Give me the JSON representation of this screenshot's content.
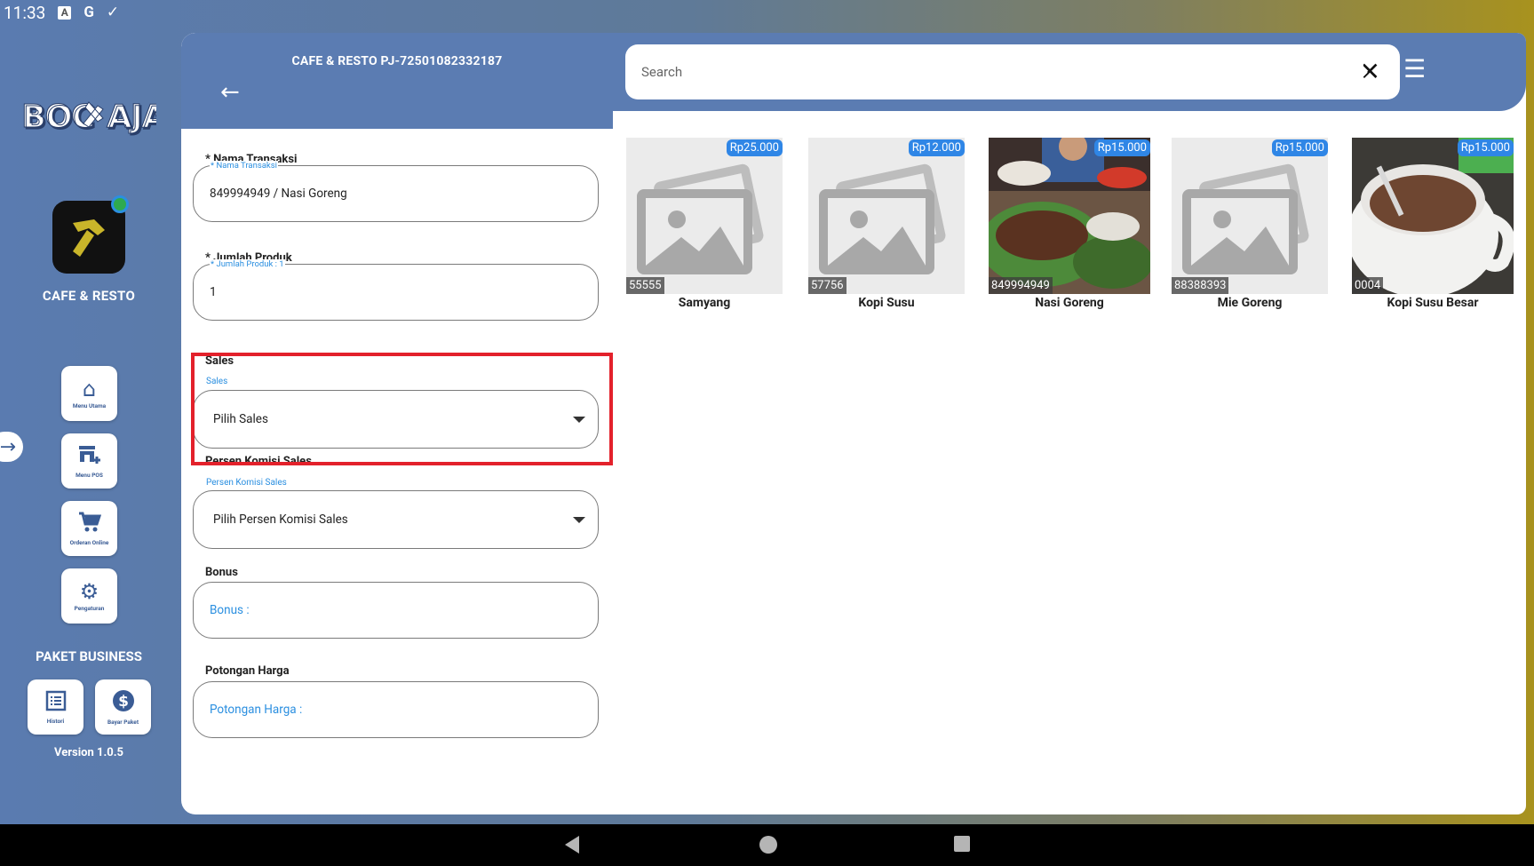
{
  "status_bar": {
    "time": "11:33",
    "icons": [
      "a-icon",
      "google-icon",
      "check-icon"
    ]
  },
  "sidebar": {
    "logo_text": "BOC AJA",
    "brand_name": "CAFE & RESTO",
    "menu": [
      {
        "label": "Menu Utama",
        "icon": "home-icon"
      },
      {
        "label": "Menu POS",
        "icon": "store-add-icon"
      },
      {
        "label": "Orderan Online",
        "icon": "cart-icon"
      },
      {
        "label": "Pengaturan",
        "icon": "gear-icon"
      }
    ],
    "paket_title": "PAKET BUSINESS",
    "paket": [
      {
        "label": "Histori",
        "icon": "list-icon"
      },
      {
        "label": "Bayar Paket",
        "icon": "dollar-icon"
      }
    ],
    "version": "Version 1.0.5"
  },
  "header": {
    "title": "CAFE & RESTO PJ-72501082332187"
  },
  "search": {
    "placeholder": "Search"
  },
  "form": {
    "nama_transaksi": {
      "label": "* Nama Transaksi",
      "float": "* Nama Transaksi",
      "value": "849994949 / Nasi Goreng"
    },
    "jumlah_produk": {
      "label": "* Jumlah Produk",
      "float": "* Jumlah Produk : 1",
      "value": "1"
    },
    "sales": {
      "label": "Sales",
      "float": "Sales",
      "value": "Pilih Sales"
    },
    "persen_komisi": {
      "label": "Persen Komisi Sales",
      "float": "Persen Komisi Sales",
      "value": "Pilih Persen Komisi Sales"
    },
    "bonus": {
      "label": "Bonus",
      "placeholder": "Bonus :"
    },
    "potongan_harga": {
      "label": "Potongan Harga",
      "placeholder": "Potongan Harga :"
    }
  },
  "products": [
    {
      "name": "Samyang",
      "price": "Rp25.000",
      "code": "55555",
      "image": "placeholder"
    },
    {
      "name": "Kopi Susu",
      "price": "Rp12.000",
      "code": "57756",
      "image": "placeholder"
    },
    {
      "name": "Nasi Goreng",
      "price": "Rp15.000",
      "code": "849994949",
      "image": "photo-food"
    },
    {
      "name": "Mie Goreng",
      "price": "Rp15.000",
      "code": "88388393",
      "image": "placeholder"
    },
    {
      "name": "Kopi Susu Besar",
      "price": "Rp15.000",
      "code": "0004",
      "image": "photo-coffee"
    }
  ],
  "colors": {
    "header_blue": "#5b7cb2",
    "accent_blue": "#2f86e6",
    "highlight_red": "#e3212b"
  }
}
